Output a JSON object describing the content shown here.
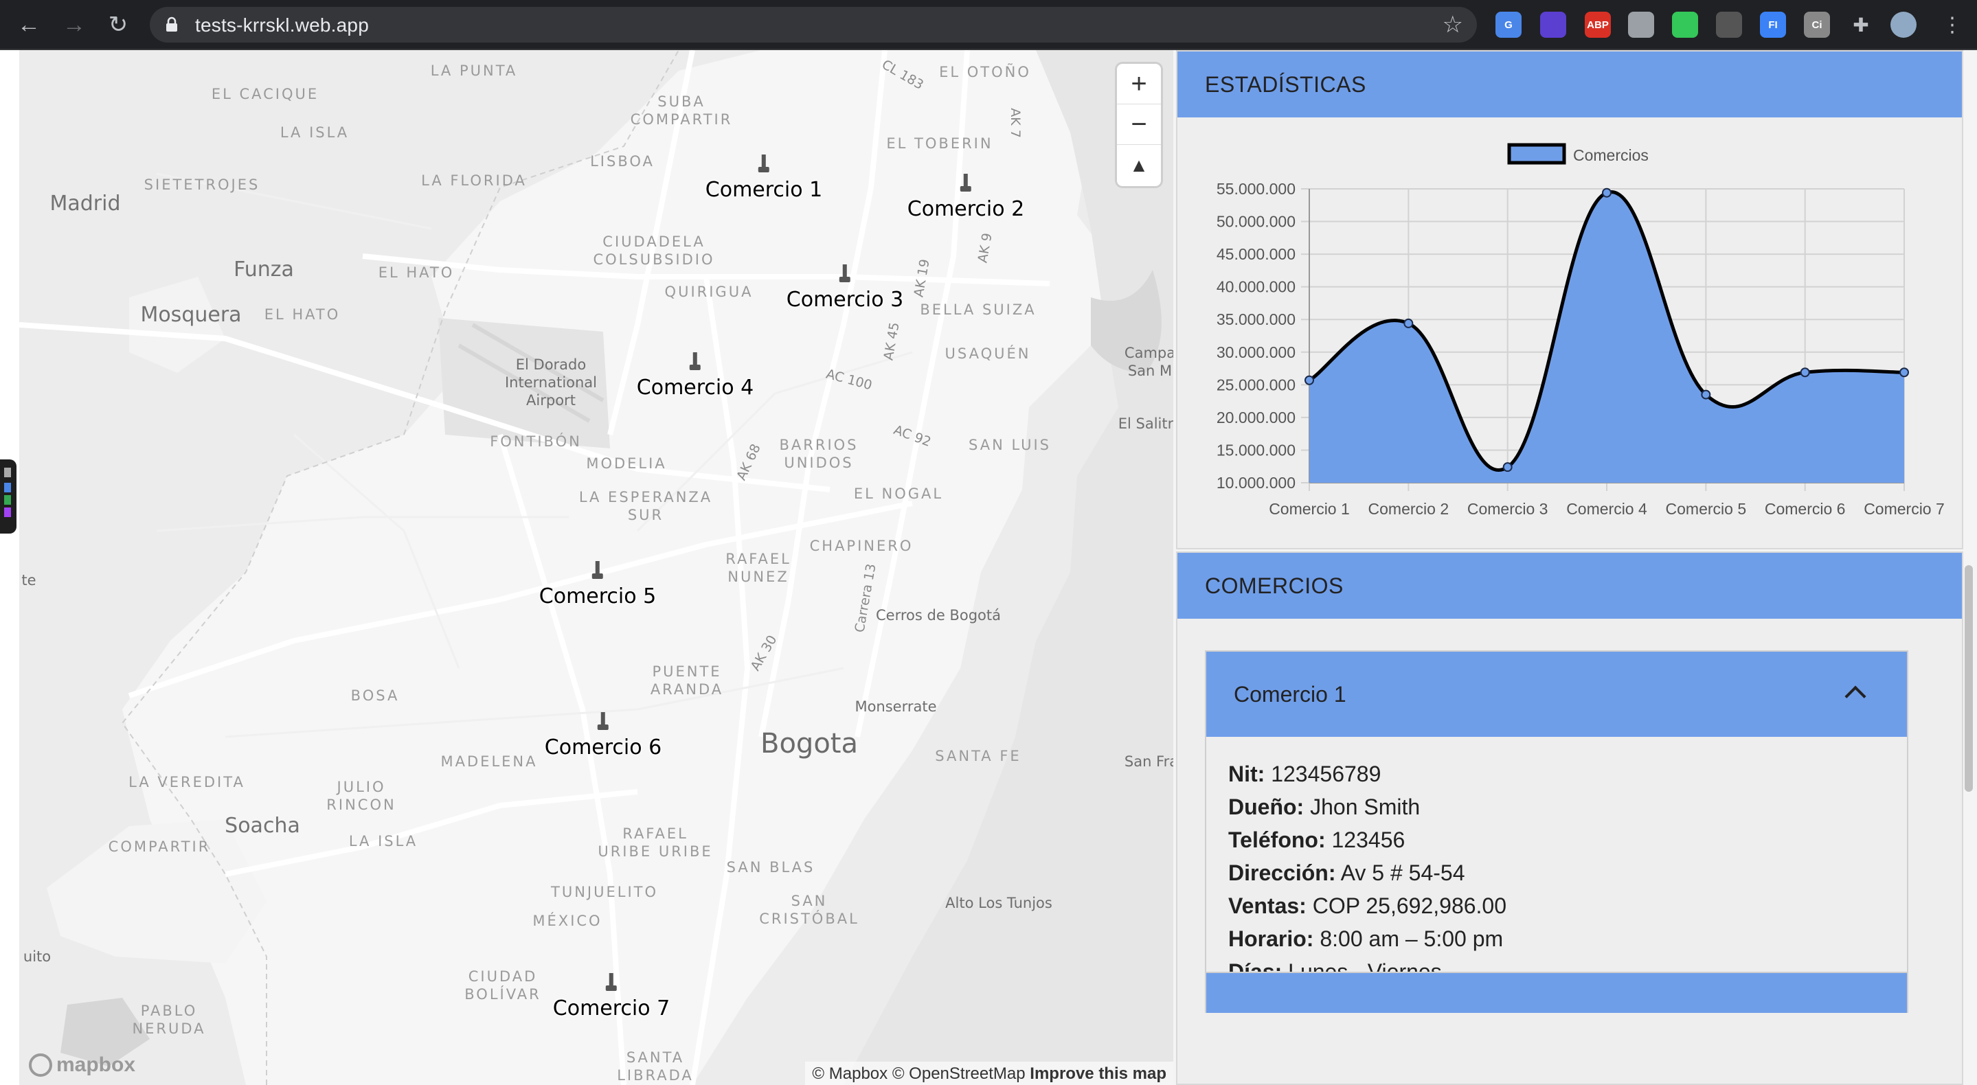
{
  "browser": {
    "url": "tests-krrskl.web.app",
    "extensions": [
      {
        "name": "google-translate-icon",
        "text": "G",
        "color": "#4a86e8"
      },
      {
        "name": "layers-extension-icon",
        "text": "",
        "color": "#5b3fd0"
      },
      {
        "name": "adblock-plus-icon",
        "text": "ABP",
        "color": "#d93025"
      },
      {
        "name": "circle-extension-icon",
        "text": "",
        "color": "#9aa0a6"
      },
      {
        "name": "target-extension-icon",
        "text": "",
        "color": "#34c759"
      },
      {
        "name": "spy-extension-icon",
        "text": "",
        "color": "#555"
      },
      {
        "name": "fi-extension-icon",
        "text": "FI",
        "color": "#3b82f6"
      },
      {
        "name": "ci-extension-icon",
        "text": "Ci",
        "color": "#888"
      },
      {
        "name": "puzzle-extensions-icon",
        "text": "",
        "color": "#bdc1c6"
      },
      {
        "name": "profile-avatar",
        "text": "",
        "color": "#8fa9c4"
      }
    ]
  },
  "map": {
    "labels": {
      "la_punta": "LA PUNTA",
      "el_otono": "EL OTOÑO",
      "cl_183": "CL 183",
      "el_cacique": "EL CACIQUE",
      "suba_compartir": "SUBA\nCOMPARTIR",
      "ak7": "AK 7",
      "la_isla": "LA ISLA",
      "el_toberin": "EL TOBERIN",
      "lisboa": "LISBOA",
      "madrid": "Madrid",
      "siete_troje": "SIETETROJES",
      "la_florida": "LA FLORIDA",
      "ciudadela": "CIUDADELA\nCOLSUBSIDIO",
      "ak9": "AK 9",
      "funza": "Funza",
      "el_hato1": "EL HATO",
      "ak19": "AK 19",
      "quirigua": "QUIRIGUA",
      "bella_suiza": "BELLA SUIZA",
      "mosquera": "Mosquera",
      "el_hato2": "EL HATO",
      "ak45": "AK 45",
      "usaquen": "USAQUÉN",
      "campa": "Campa\nSan M",
      "airport": "El Dorado\nInternational\nAirport",
      "ac100": "AC 100",
      "el_salitre": "El Salitr",
      "fontibon": "FONTIBÓN",
      "ac92": "AC 92",
      "barrios_unidos": "BARRIOS\nUNIDOS",
      "san_luis": "SAN LUIS",
      "modelia": "MODELIA",
      "ak68": "AK 68",
      "la_esperanza": "LA ESPERANZA\nSUR",
      "el_nogal": "EL NOGAL",
      "chapinero": "CHAPINERO",
      "rafael_nunez": "RAFAEL\nNUNEZ",
      "te": "te",
      "carrera13": "Carrera 13",
      "cerros": "Cerros de Bogotá",
      "ak30": "AK 30",
      "puente_aranda": "PUENTE\nARANDA",
      "bosa": "BOSA",
      "monserrate": "Monserrate",
      "bogota": "Bogota",
      "madelena": "MADELENA",
      "santa_fe": "SANTA FE",
      "san_fra": "San Fra",
      "la_veredita": "LA VEREDITA",
      "julio_rincon": "JULIO\nRINCON",
      "soacha": "Soacha",
      "compartir": "COMPARTIR",
      "la_isla2": "LA ISLA",
      "rafael_uribe": "RAFAEL\nURIBE URIBE",
      "san_blas": "SAN BLAS",
      "alto_tunjos": "Alto Los Tunjos",
      "tunjuelito": "TUNJUELITO",
      "san_cristobal": "SAN\nCRISTÓBAL",
      "mexico": "MÉXICO",
      "quito": "uito",
      "ciudad_bolivar": "CIUDAD\nBOLÍVAR",
      "pablo_neruda": "PABLO\nNERUDA",
      "santa_librada": "SANTA\nLIBRADA"
    },
    "markers": [
      "Comercio 1",
      "Comercio 2",
      "Comercio 3",
      "Comercio 4",
      "Comercio 5",
      "Comercio 6",
      "Comercio 7"
    ],
    "zoom_in": "+",
    "zoom_out": "−",
    "compass": "▲",
    "logo": "mapbox",
    "attribution": "© Mapbox © OpenStreetMap",
    "improve": "Improve this map"
  },
  "stats": {
    "title": "ESTADÍSTICAS"
  },
  "chart_data": {
    "type": "area",
    "categories": [
      "Comercio 1",
      "Comercio 2",
      "Comercio 3",
      "Comercio 4",
      "Comercio 5",
      "Comercio 6",
      "Comercio 7"
    ],
    "series": [
      {
        "name": "Comercios",
        "values": [
          25692986,
          34400000,
          12400000,
          54400000,
          23500000,
          26900000,
          26900000
        ],
        "color": "#6f9ee9"
      }
    ],
    "yticks": [
      "55.000.000",
      "50.000.000",
      "45.000.000",
      "40.000.000",
      "35.000.000",
      "30.000.000",
      "25.000.000",
      "20.000.000",
      "15.000.000",
      "10.000.000"
    ],
    "ylim": [
      10000000,
      55000000
    ],
    "legend_position": "top",
    "grid": true
  },
  "comercios": {
    "title": "COMERCIOS",
    "item": {
      "name": "Comercio 1",
      "nit_label": "Nit:",
      "nit": "123456789",
      "owner_label": "Dueño:",
      "owner": "Jhon Smith",
      "phone_label": "Teléfono:",
      "phone": "123456",
      "address_label": "Dirección:",
      "address": "Av 5 # 54-54",
      "sales_label": "Ventas:",
      "sales": "COP 25,692,986.00",
      "hours_label": "Horario:",
      "hours": "8:00 am – 5:00 pm",
      "days_label": "Días:",
      "days": "Lunes - Viernes"
    }
  }
}
